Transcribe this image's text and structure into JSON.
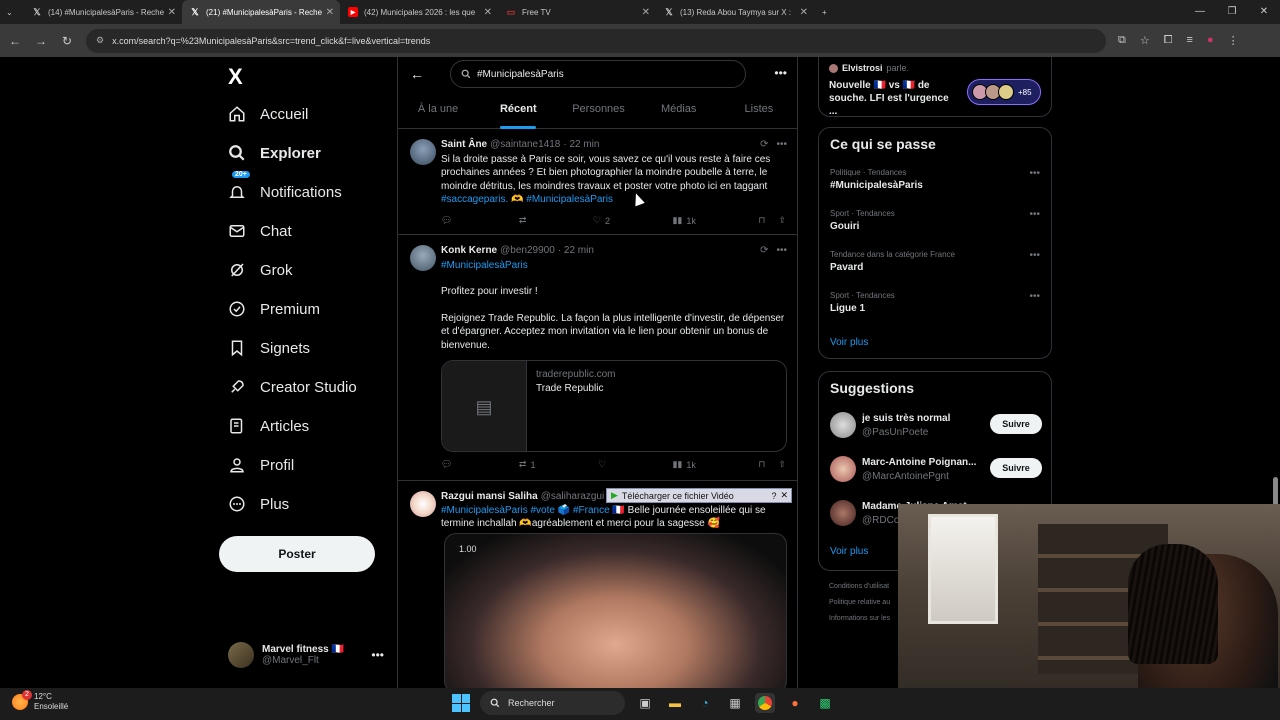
{
  "browser": {
    "tabs": [
      {
        "title": "(14) #MunicipalesàParis - Reche",
        "icon": "x-logo"
      },
      {
        "title": "(21) #MunicipalesàParis - Reche",
        "icon": "x-logo"
      },
      {
        "title": "(42) Municipales 2026 : les que",
        "icon": "youtube-icon"
      },
      {
        "title": "Free TV",
        "icon": "tv-icon"
      },
      {
        "title": "(13) Reda Abou Taymya sur X :",
        "icon": "x-logo"
      }
    ],
    "new_tab": "+",
    "url": "x.com/search?q=%23MunicipalesàParis&src=trend_click&f=live&vertical=trends"
  },
  "left_nav": {
    "logo": "X",
    "items": [
      {
        "label": "Accueil",
        "icon": "home-icon"
      },
      {
        "label": "Explorer",
        "icon": "search-icon"
      },
      {
        "label": "Notifications",
        "icon": "bell-icon",
        "badge": "20+"
      },
      {
        "label": "Chat",
        "icon": "mail-icon"
      },
      {
        "label": "Grok",
        "icon": "grok-icon"
      },
      {
        "label": "Premium",
        "icon": "verified-icon"
      },
      {
        "label": "Signets",
        "icon": "bookmark-icon"
      },
      {
        "label": "Creator Studio",
        "icon": "rocket-icon"
      },
      {
        "label": "Articles",
        "icon": "article-icon"
      },
      {
        "label": "Profil",
        "icon": "person-icon"
      },
      {
        "label": "Plus",
        "icon": "more-circle-icon"
      }
    ],
    "post_button": "Poster",
    "account": {
      "name": "Marvel fitness 🇫🇷",
      "handle": "@Marvel_Flt"
    }
  },
  "search": {
    "query": "#MunicipalesàParis",
    "tabs": [
      "À la une",
      "Récent",
      "Personnes",
      "Médias",
      "Listes"
    ],
    "active_tab": "Récent"
  },
  "tweets": [
    {
      "name": "Saint Âne",
      "handle": "@saintane1418",
      "time": "· 22 min",
      "text": "Si la droite passe à Paris ce soir, vous savez ce qu'il vous reste à faire ces prochaines années ? Et bien photographier la moindre poubelle à terre, le moindre détritus, les moindres travaux et poster votre photo ici en taggant",
      "tags": "#saccageparis. 🫶 #MunicipalesàParis",
      "replies": "",
      "retweets": "",
      "likes": "2",
      "views": "1k"
    },
    {
      "name": "Konk Kerne",
      "handle": "@ben29900",
      "time": "· 22 min",
      "tag_line": "#MunicipalesàParis",
      "line1": "Profitez pour investir !",
      "line2": "Rejoignez Trade Republic. La façon la plus intelligente d'investir, de dépenser et d'épargner. Acceptez mon invitation via le lien pour obtenir un bonus de bienvenue.",
      "card_domain": "traderepublic.com",
      "card_title": "Trade Republic",
      "replies": "",
      "retweets": "1",
      "likes": "",
      "views": "1k"
    },
    {
      "name": "Razgui mansi Saliha",
      "handle": "@saliharazgui",
      "tags": "#MunicipalesàParis #vote 🗳️ #France 🇫🇷",
      "text": "Belle journée ensoleillée qui se termine inchallah 🫶agréablement et merci pour la sagesse 🥰",
      "media_time": "1.00"
    }
  ],
  "download_bar": "Télécharger ce fichier Vidéo",
  "right": {
    "spaces": {
      "host": "Elvistrosi",
      "host_meta": "parle.",
      "title": "Nouvelle 🇫🇷 vs 🇫🇷 de souche. LFI est l'urgence ...",
      "count": "+85"
    },
    "trends_title": "Ce qui se passe",
    "trends": [
      {
        "meta": "Politique · Tendances",
        "name": "#MunicipalesàParis"
      },
      {
        "meta": "Sport · Tendances",
        "name": "Gouiri"
      },
      {
        "meta": "Tendance dans la catégorie France",
        "name": "Pavard"
      },
      {
        "meta": "Sport · Tendances",
        "name": "Ligue 1"
      }
    ],
    "trends_more": "Voir plus",
    "suggestions_title": "Suggestions",
    "suggestions": [
      {
        "name": "je suis très normal",
        "handle": "@PasUnPoete",
        "button": "Suivre"
      },
      {
        "name": "Marc-Antoine Poignan...",
        "handle": "@MarcAntoinePgnt",
        "button": "Suivre"
      },
      {
        "name": "Madame Juliane Amet",
        "handle": "@RDCo",
        "button": ""
      }
    ],
    "suggestions_more": "Voir plus",
    "legal": [
      "Conditions d'utilisat",
      "Politique relative au",
      "Informations sur les"
    ]
  },
  "taskbar": {
    "temp": "12°C",
    "weather": "Ensoleillé",
    "search": "Rechercher"
  }
}
